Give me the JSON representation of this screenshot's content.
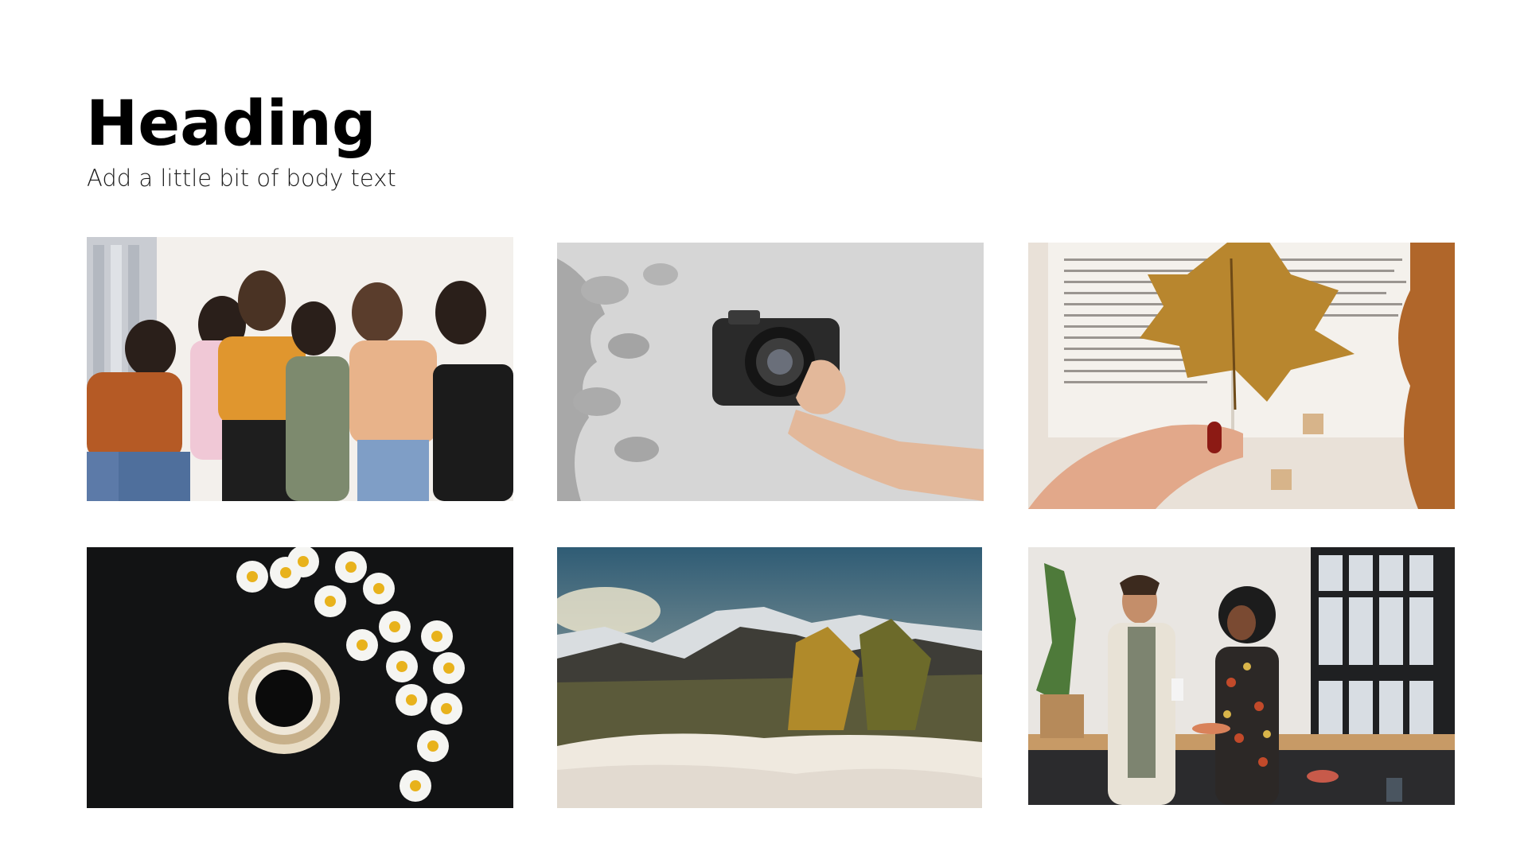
{
  "slide": {
    "heading": "Heading",
    "body_text": "Add a little bit of body text"
  },
  "photos": [
    {
      "subject": "group-of-friends-photo"
    },
    {
      "subject": "hand-holding-camera-photo"
    },
    {
      "subject": "autumn-leaf-over-book-photo"
    },
    {
      "subject": "coffee-cup-and-daisies-photo"
    },
    {
      "subject": "snowy-mountain-landscape-photo"
    },
    {
      "subject": "people-in-kitchen-photo"
    }
  ]
}
